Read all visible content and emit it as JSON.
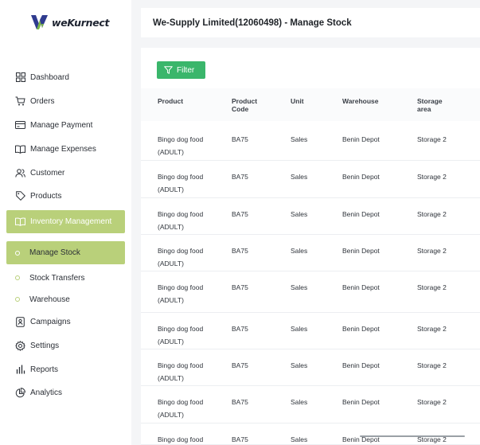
{
  "brand": {
    "name": "weKurnect",
    "accent": "#b9d07a",
    "filter_color": "#3ab66b"
  },
  "sidebar": {
    "items": [
      {
        "label": "Dashboard",
        "icon": "dashboard-icon"
      },
      {
        "label": "Orders",
        "icon": "cart-icon"
      },
      {
        "label": "Manage Payment",
        "icon": "payment-card-icon"
      },
      {
        "label": "Manage Expenses",
        "icon": "book-icon"
      },
      {
        "label": "Customer",
        "icon": "users-icon"
      },
      {
        "label": "Products",
        "icon": "tag-icon"
      },
      {
        "label": "Inventory Management",
        "icon": "book-icon",
        "active": true
      }
    ],
    "subitems": [
      {
        "label": "Manage Stock",
        "active": true
      },
      {
        "label": "Stock Transfers"
      },
      {
        "label": "Warehouse"
      }
    ],
    "bottom_items": [
      {
        "label": "Campaigns",
        "icon": "campaign-icon"
      },
      {
        "label": "Settings",
        "icon": "gear-icon"
      },
      {
        "label": "Reports",
        "icon": "bar-chart-icon"
      },
      {
        "label": "Analytics",
        "icon": "pie-chart-icon"
      }
    ]
  },
  "header": {
    "title": "We-Supply Limited(12060498) - Manage Stock"
  },
  "toolbar": {
    "filter_label": "Filter",
    "filter_icon": "filter-icon"
  },
  "table": {
    "columns": [
      {
        "line1": "Product",
        "line2": ""
      },
      {
        "line1": "Product",
        "line2": "Code"
      },
      {
        "line1": "Unit",
        "line2": ""
      },
      {
        "line1": "Warehouse",
        "line2": ""
      },
      {
        "line1": "Storage",
        "line2": "area"
      }
    ],
    "rows": [
      {
        "product_line1": "Bingo dog food",
        "product_line2": "(ADULT)",
        "code": "BA75",
        "unit": "Sales",
        "warehouse": "Benin Depot",
        "storage": "Storage 2"
      },
      {
        "product_line1": "Bingo dog food",
        "product_line2": "(ADULT)",
        "code": "BA75",
        "unit": "Sales",
        "warehouse": "Benin Depot",
        "storage": "Storage 2"
      },
      {
        "product_line1": "Bingo dog food",
        "product_line2": "(ADULT)",
        "code": "BA75",
        "unit": "Sales",
        "warehouse": "Benin Depot",
        "storage": "Storage 2"
      },
      {
        "product_line1": "Bingo dog food",
        "product_line2": "(ADULT)",
        "code": "BA75",
        "unit": "Sales",
        "warehouse": "Benin Depot",
        "storage": "Storage 2"
      },
      {
        "product_line1": "Bingo dog food",
        "product_line2": "(ADULT)",
        "code": "BA75",
        "unit": "Sales",
        "warehouse": "Benin Depot",
        "storage": "Storage 2"
      },
      {
        "product_line1": "Bingo dog food",
        "product_line2": "(ADULT)",
        "code": "BA75",
        "unit": "Sales",
        "warehouse": "Benin Depot",
        "storage": "Storage 2"
      },
      {
        "product_line1": "Bingo dog food",
        "product_line2": "(ADULT)",
        "code": "BA75",
        "unit": "Sales",
        "warehouse": "Benin Depot",
        "storage": "Storage 2"
      },
      {
        "product_line1": "Bingo dog food",
        "product_line2": "(ADULT)",
        "code": "BA75",
        "unit": "Sales",
        "warehouse": "Benin Depot",
        "storage": "Storage 2"
      },
      {
        "product_line1": "Bingo dog food",
        "product_line2": "",
        "code": "BA75",
        "unit": "Sales",
        "warehouse": "Benin Depot",
        "storage": "Storage 2"
      }
    ]
  }
}
